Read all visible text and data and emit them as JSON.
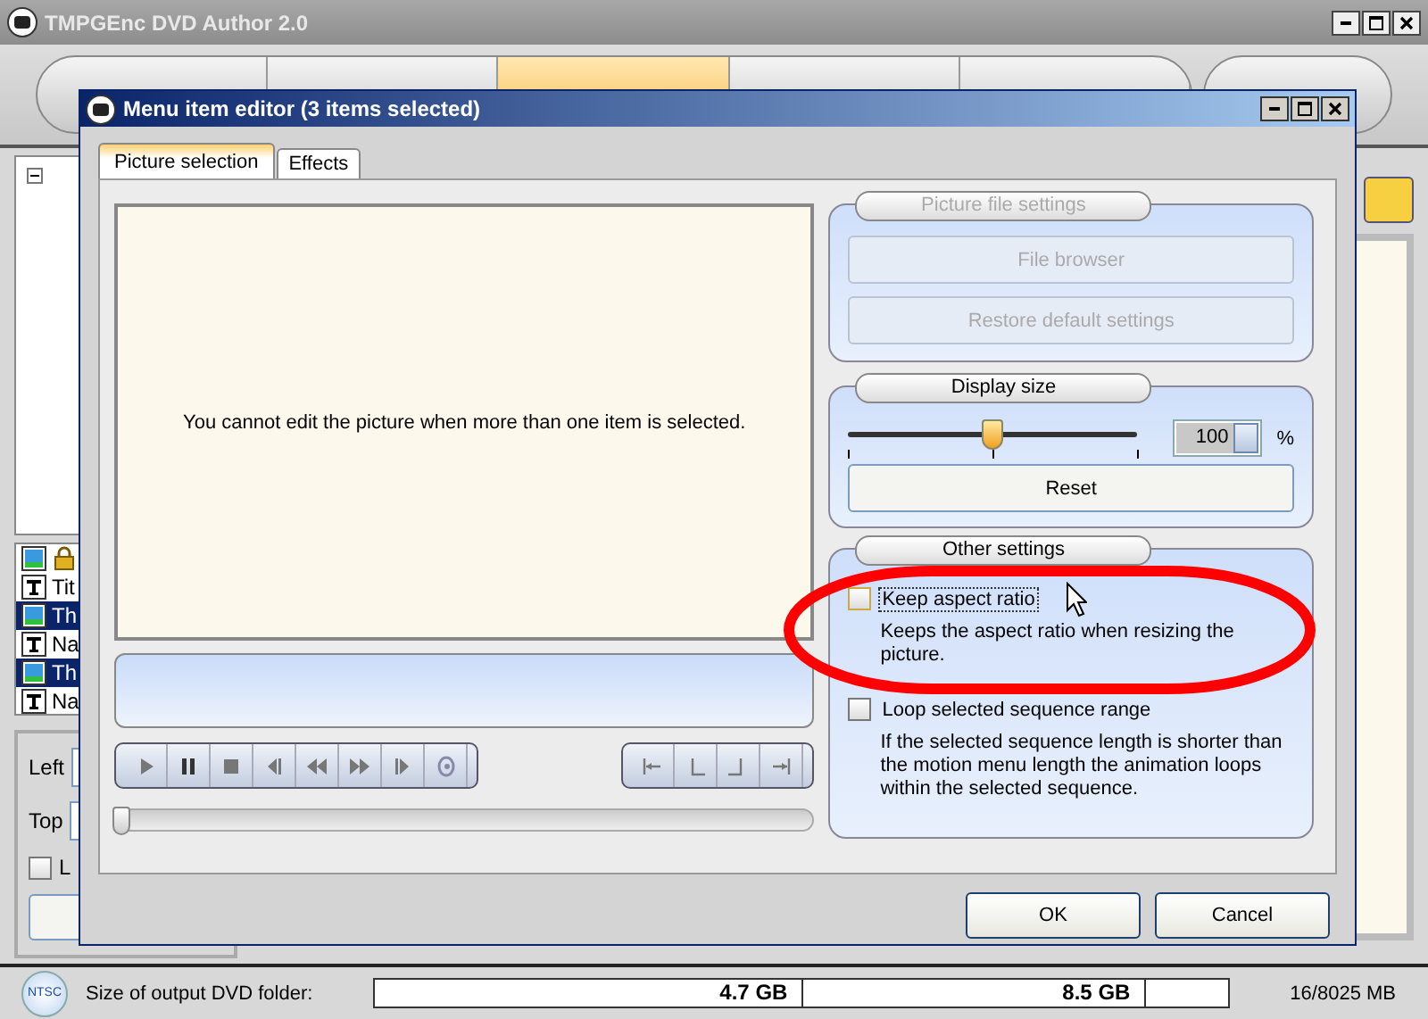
{
  "window": {
    "title": "TMPGEnc DVD Author 2.0"
  },
  "main_tabs": [
    {
      "selected": false
    },
    {
      "selected": false
    },
    {
      "selected": true
    },
    {
      "selected": false
    },
    {
      "selected": false
    }
  ],
  "tree_items": [
    {
      "kind": "image",
      "locked": true,
      "selected": false
    },
    {
      "kind": "text",
      "label": "Tit",
      "locked": false,
      "selected": false
    },
    {
      "kind": "image",
      "label": "Th",
      "locked": false,
      "selected": true
    },
    {
      "kind": "text",
      "label": "Na",
      "locked": false,
      "selected": false
    },
    {
      "kind": "image",
      "label": "Th",
      "locked": false,
      "selected": true
    },
    {
      "kind": "text",
      "label": "Na",
      "locked": false,
      "selected": false
    }
  ],
  "position_fields": [
    {
      "label": "Left"
    },
    {
      "label": "Top"
    }
  ],
  "option_checkbox": {
    "label": "L",
    "checked": false
  },
  "status_bar": {
    "video_standard": "NTSC",
    "size_label": "Size of output DVD folder:",
    "marks": [
      "4.7 GB",
      "8.5 GB"
    ],
    "usage": "16/8025 MB"
  },
  "dialog": {
    "title": "Menu item editor (3 items selected)",
    "tabs": [
      {
        "label": "Picture selection",
        "selected": true
      },
      {
        "label": "Effects",
        "selected": false
      }
    ],
    "message": "You cannot edit the picture when more than one item is selected.",
    "seek": {
      "level": 0
    },
    "picture_file_settings": {
      "title": "Picture file settings",
      "disabled": true,
      "buttons": [
        "File browser",
        "Restore default settings"
      ]
    },
    "display_size": {
      "title": "Display size",
      "level": 0.5,
      "value": "100",
      "unit": "%",
      "button": "Reset"
    },
    "other_settings": {
      "title": "Other settings",
      "options": [
        {
          "label": "Keep aspect ratio",
          "checked": false,
          "hovered": true,
          "description": "Keeps the aspect ratio when resizing the picture."
        },
        {
          "label": "Loop selected sequence range",
          "checked": false,
          "hovered": false,
          "description": "If the selected sequence length is shorter than the motion menu length the animation loops within the selected sequence."
        }
      ]
    },
    "buttons": [
      "OK",
      "Cancel"
    ]
  }
}
